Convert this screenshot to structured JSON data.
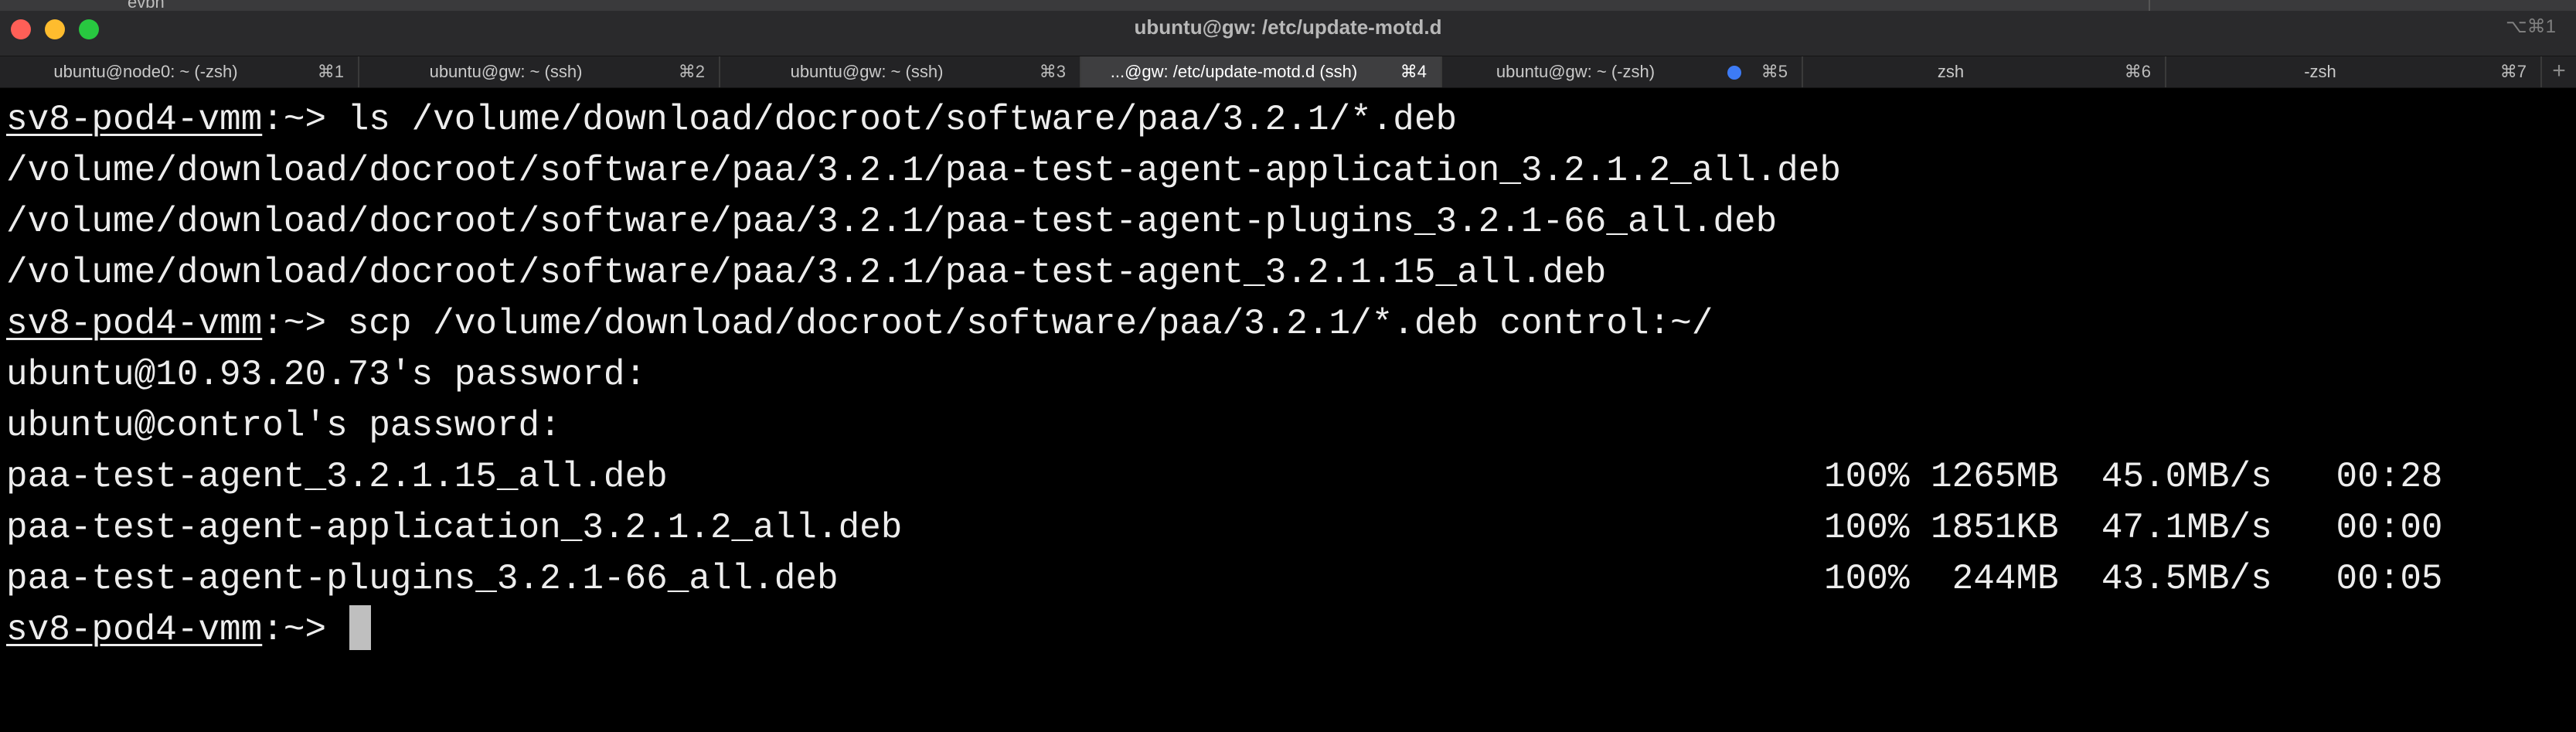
{
  "window": {
    "behind_text": "evbn",
    "title": "ubuntu@gw: /etc/update-motd.d",
    "shortcut": "⌥⌘1"
  },
  "tabs": [
    {
      "label": "ubuntu@node0: ~ (-zsh)",
      "shortcut": "⌘1"
    },
    {
      "label": "ubuntu@gw: ~ (ssh)",
      "shortcut": "⌘2"
    },
    {
      "label": "ubuntu@gw: ~ (ssh)",
      "shortcut": "⌘3"
    },
    {
      "label": "...@gw: /etc/update-motd.d (ssh)",
      "shortcut": "⌘4"
    },
    {
      "label": "ubuntu@gw: ~ (-zsh)",
      "shortcut": "⌘5"
    },
    {
      "label": "zsh",
      "shortcut": "⌘6"
    },
    {
      "label": "-zsh",
      "shortcut": "⌘7"
    }
  ],
  "tab_add": "+",
  "terminal": {
    "prompt_host": "sv8-pod4-vmm",
    "prompt_suffix": ":~> ",
    "cmd1": "ls /volume/download/docroot/software/paa/3.2.1/*.deb",
    "out1": "/volume/download/docroot/software/paa/3.2.1/paa-test-agent-application_3.2.1.2_all.deb",
    "out2": "/volume/download/docroot/software/paa/3.2.1/paa-test-agent-plugins_3.2.1-66_all.deb",
    "out3": "/volume/download/docroot/software/paa/3.2.1/paa-test-agent_3.2.1.15_all.deb",
    "cmd2": "scp /volume/download/docroot/software/paa/3.2.1/*.deb control:~/",
    "pw1": "ubuntu@10.93.20.73's password:",
    "pw2": "ubuntu@control's password:",
    "transfers": [
      {
        "file": "paa-test-agent_3.2.1.15_all.deb",
        "stats": "100% 1265MB  45.0MB/s   00:28"
      },
      {
        "file": "paa-test-agent-application_3.2.1.2_all.deb",
        "stats": "100% 1851KB  47.1MB/s   00:00"
      },
      {
        "file": "paa-test-agent-plugins_3.2.1-66_all.deb",
        "stats": "100%  244MB  43.5MB/s   00:05"
      }
    ]
  }
}
